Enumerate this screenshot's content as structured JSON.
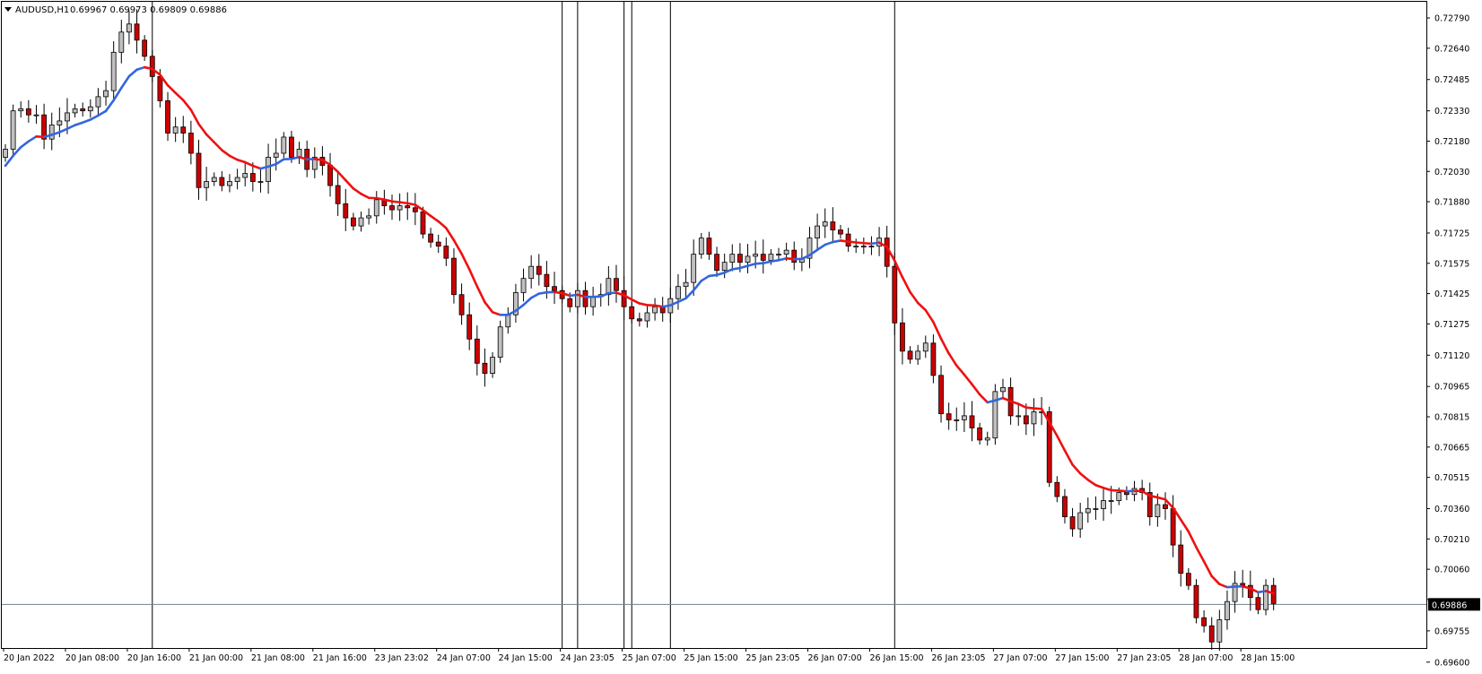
{
  "header": {
    "symbol": "AUDUSD,H1",
    "ohlc": "0.69967 0.69973 0.69809 0.69886",
    "icon": "triangle-down-icon"
  },
  "current_price_label": "0.69886",
  "colors": {
    "bull_candle": "#c0c0c0",
    "bear_candle": "#cc0000",
    "candle_outline": "#000000",
    "ma_up": "#3366dd",
    "ma_down": "#ee1111",
    "price_line": "#708090",
    "price_tag_bg": "#000000"
  },
  "chart_data": {
    "type": "candlestick",
    "symbol": "AUDUSD",
    "timeframe": "H1",
    "ylim": [
      0.6967,
      0.7287
    ],
    "y_ticks": [
      "0.72790",
      "0.72640",
      "0.72485",
      "0.72330",
      "0.72180",
      "0.72030",
      "0.71880",
      "0.71725",
      "0.71575",
      "0.71425",
      "0.71275",
      "0.71120",
      "0.70965",
      "0.70815",
      "0.70665",
      "0.70515",
      "0.70360",
      "0.70210",
      "0.70060",
      "0.69910",
      "0.69755",
      "0.69600"
    ],
    "y_tick_labels_shown": [
      "0.72790",
      "0.72640",
      "0.72485",
      "0.72330",
      "0.72180",
      "0.72030",
      "0.71880",
      "0.71725",
      "0.71575",
      "0.71425",
      "0.71275",
      "0.71120",
      "0.70965",
      "0.70815",
      "0.70665",
      "0.70515",
      "0.70360",
      "0.70210",
      "0.70060",
      "",
      "0.69755",
      "0.69600"
    ],
    "x_tick_labels": [
      {
        "label": "20 Jan 2022",
        "index": 0
      },
      {
        "label": "20 Jan 08:00",
        "index": 8
      },
      {
        "label": "20 Jan 16:00",
        "index": 16
      },
      {
        "label": "21 Jan 00:00",
        "index": 24
      },
      {
        "label": "21 Jan 08:00",
        "index": 32
      },
      {
        "label": "21 Jan 16:00",
        "index": 40
      },
      {
        "label": "23 Jan 23:02",
        "index": 48
      },
      {
        "label": "24 Jan 07:00",
        "index": 56
      },
      {
        "label": "24 Jan 15:00",
        "index": 64
      },
      {
        "label": "24 Jan 23:05",
        "index": 72
      },
      {
        "label": "25 Jan 07:00",
        "index": 80
      },
      {
        "label": "25 Jan 15:00",
        "index": 88
      },
      {
        "label": "25 Jan 23:05",
        "index": 96
      },
      {
        "label": "26 Jan 07:00",
        "index": 104
      },
      {
        "label": "26 Jan 15:00",
        "index": 112
      },
      {
        "label": "26 Jan 23:05",
        "index": 120
      },
      {
        "label": "27 Jan 07:00",
        "index": 128
      },
      {
        "label": "27 Jan 15:00",
        "index": 136
      },
      {
        "label": "27 Jan 23:05",
        "index": 144
      },
      {
        "label": "28 Jan 07:00",
        "index": 152
      },
      {
        "label": "28 Jan 15:00",
        "index": 160
      }
    ],
    "vertical_lines_at_index": [
      19,
      72,
      74,
      80,
      81,
      86,
      115
    ],
    "closes": [
      0.7214,
      0.7233,
      0.7234,
      0.7231,
      0.7231,
      0.7219,
      0.7226,
      0.7228,
      0.7232,
      0.7234,
      0.7233,
      0.7235,
      0.724,
      0.7243,
      0.7262,
      0.7272,
      0.7276,
      0.7268,
      0.726,
      0.725,
      0.7238,
      0.7222,
      0.7225,
      0.7222,
      0.7212,
      0.7195,
      0.7198,
      0.72,
      0.7196,
      0.7198,
      0.72,
      0.7202,
      0.7198,
      0.7198,
      0.721,
      0.7212,
      0.722,
      0.721,
      0.7214,
      0.7204,
      0.721,
      0.7206,
      0.7196,
      0.7187,
      0.718,
      0.7176,
      0.718,
      0.7181,
      0.7189,
      0.7186,
      0.7184,
      0.7186,
      0.7185,
      0.7183,
      0.7172,
      0.7168,
      0.7166,
      0.716,
      0.7142,
      0.7132,
      0.712,
      0.7108,
      0.7103,
      0.7111,
      0.7126,
      0.7132,
      0.7143,
      0.715,
      0.7156,
      0.7152,
      0.7146,
      0.7144,
      0.714,
      0.7136,
      0.7144,
      0.7136,
      0.7141,
      0.7142,
      0.715,
      0.7144,
      0.7136,
      0.713,
      0.7129,
      0.7133,
      0.7136,
      0.7133,
      0.714,
      0.7146,
      0.7148,
      0.7162,
      0.717,
      0.7162,
      0.7154,
      0.7158,
      0.7162,
      0.7158,
      0.7161,
      0.7162,
      0.7159,
      0.7162,
      0.7162,
      0.7164,
      0.7158,
      0.716,
      0.717,
      0.7176,
      0.7178,
      0.7174,
      0.7172,
      0.7166,
      0.7166,
      0.7166,
      0.7166,
      0.717,
      0.7156,
      0.7128,
      0.7114,
      0.711,
      0.7114,
      0.7118,
      0.7102,
      0.7083,
      0.708,
      0.708,
      0.7082,
      0.7076,
      0.707,
      0.7071,
      0.7094,
      0.7096,
      0.7082,
      0.7082,
      0.7078,
      0.7084,
      0.7084,
      0.7049,
      0.7042,
      0.7032,
      0.7026,
      0.7034,
      0.7036,
      0.7036,
      0.704,
      0.704,
      0.7044,
      0.7043,
      0.7046,
      0.7044,
      0.7032,
      0.7038,
      0.7036,
      0.7018,
      0.7004,
      0.6998,
      0.6982,
      0.6978,
      0.697,
      0.6981,
      0.699,
      0.6999,
      0.6998,
      0.6992,
      0.6986,
      0.6998,
      0.6989
    ],
    "ma_type": "moving average (color-switching)",
    "current_price": 0.69886
  }
}
